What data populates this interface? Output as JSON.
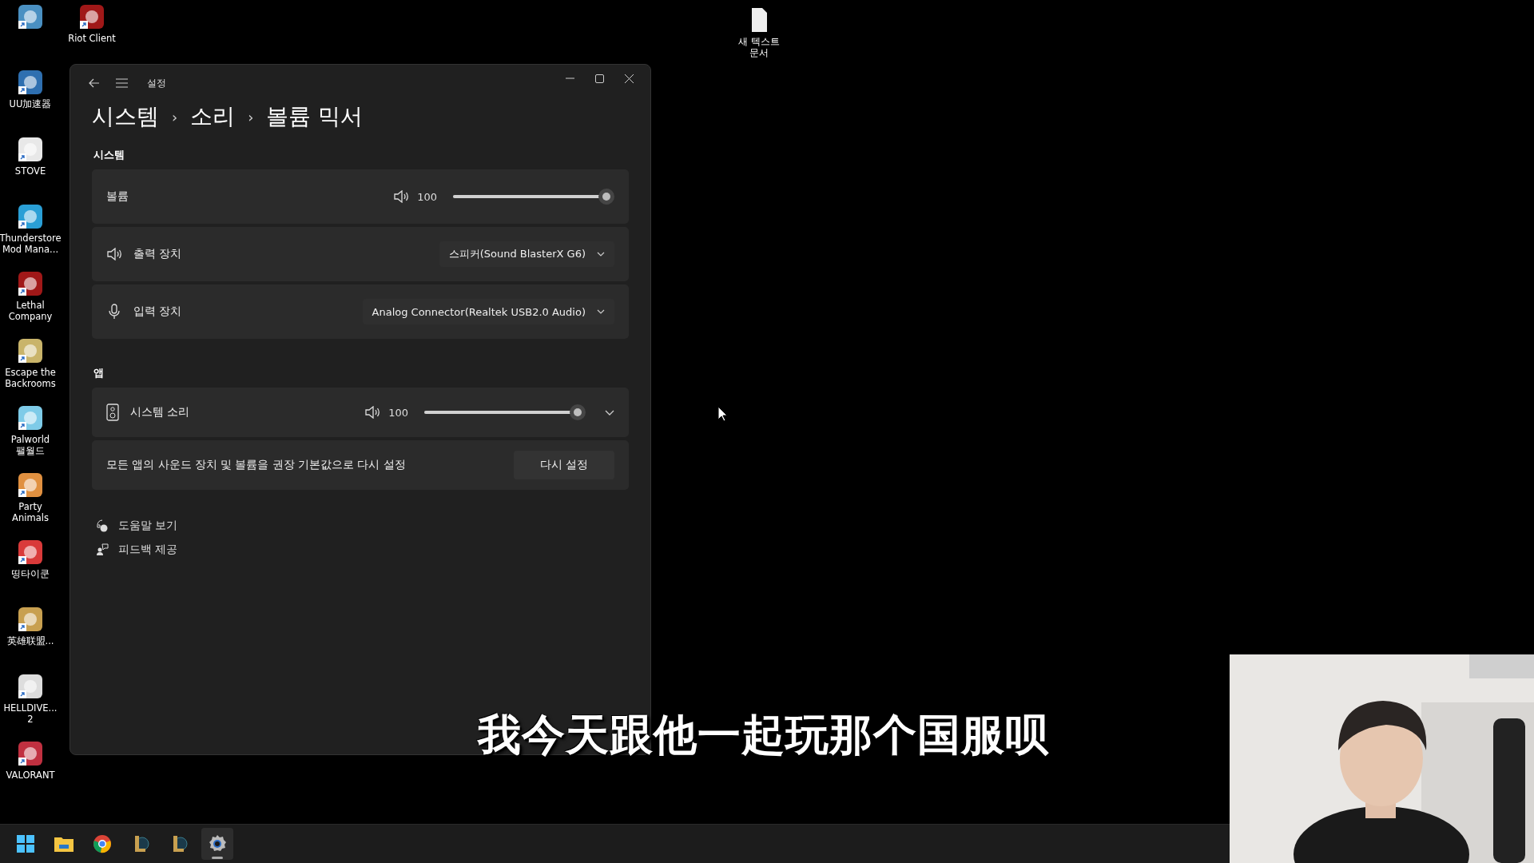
{
  "desktop": {
    "column_icons": [
      {
        "label": "UU加速器"
      },
      {
        "label": "STOVE"
      },
      {
        "label": "Thunderstore\nMod Mana..."
      },
      {
        "label": "Lethal\nCompany"
      },
      {
        "label": "Escape the\nBackrooms"
      },
      {
        "label": "Palworld\n팰월드"
      },
      {
        "label": "Party\nAnimals"
      },
      {
        "label": "띵타이쿤"
      },
      {
        "label": "英雄联盟..."
      },
      {
        "label": "HELLDIVE...\n2"
      },
      {
        "label": "VALORANT"
      }
    ],
    "other_icons": [
      {
        "label": "Riot Client"
      },
      {
        "label": "새 텍스트\n문서"
      }
    ]
  },
  "window": {
    "title": "설정",
    "breadcrumb": [
      {
        "text": "시스템"
      },
      {
        "separator": "›",
        "text": "소리"
      },
      {
        "separator": "›",
        "text": "볼륨 믹서"
      }
    ],
    "system_section": {
      "heading": "시스템",
      "volume": {
        "label": "볼륨",
        "reading": "100",
        "level": 1.0
      },
      "output": {
        "label": "출력 장치",
        "value": "스피커(Sound BlasterX G6)"
      },
      "input": {
        "label": "입력 장치",
        "value": "Analog Connector(Realtek USB2.0 Audio)"
      }
    },
    "apps_section": {
      "heading": "앱",
      "apps": [
        {
          "name": "시스템 소리",
          "reading": "100",
          "level": 1.0,
          "expanded": false
        }
      ],
      "reset": {
        "text": "모든 앱의 사운드 장치 및 볼륨을 권장 기본값으로 다시 설정",
        "button": "다시 설정"
      }
    },
    "links": [
      {
        "kind": "help",
        "label": "도움말 보기"
      },
      {
        "kind": "feedback",
        "label": "피드백 제공"
      }
    ]
  },
  "subtitle": "我今天跟他一起玩那个国服呗",
  "taskbar": {
    "apps": [
      {
        "kind": "start",
        "selected": false
      },
      {
        "kind": "folder",
        "selected": false
      },
      {
        "kind": "browser",
        "selected": false
      },
      {
        "kind": "game",
        "selected": false
      },
      {
        "kind": "game",
        "selected": false
      },
      {
        "kind": "settings",
        "selected": true
      }
    ]
  }
}
